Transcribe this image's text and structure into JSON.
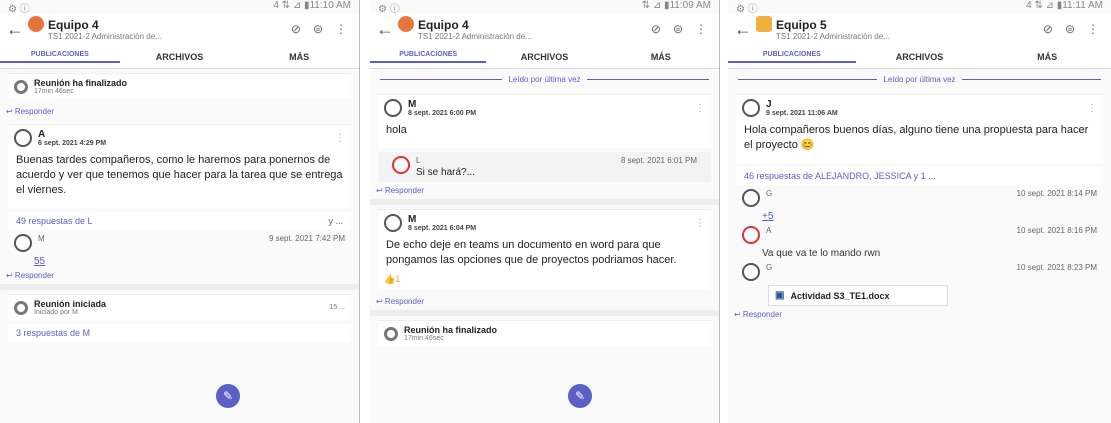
{
  "panels": [
    {
      "status_time": "4 ⇅ ⊿ ▮11:10 AM",
      "team_name": "Equipo 4",
      "subtitle": "TS1 2021-2 Administración de...",
      "tabs": [
        "PUBLICACIONES",
        "ARCHIVOS",
        "MÁS"
      ],
      "system1": {
        "title": "Reunión ha finalizado",
        "sub": "17min 46sec"
      },
      "reply_label": "↩ Responder",
      "post": {
        "author": "A",
        "date": "6 sept. 2021 4:29 PM",
        "body": "Buenas tardes compañeros, como le haremos para ponernos de acuerdo y ver que tenemos que hacer para la tarea que se entrega el viernes."
      },
      "replies_label": "49 respuestas de L",
      "replies_tail": "y ...",
      "subreply": {
        "author": "M",
        "date": "9 sept. 2021 7:42 PM",
        "text": "55"
      },
      "system2": {
        "title": "Reunión iniciada",
        "sub": "Iniciado por M",
        "tail": "15 ..."
      },
      "replies2_label": "3 respuestas de M"
    },
    {
      "status_time": "⇅ ⊿ ▮11:09 AM",
      "team_name": "Equipo 4",
      "subtitle": "TS1 2021-2 Administración de...",
      "tabs": [
        "PUBLICACIONES",
        "ARCHIVOS",
        "MÁS"
      ],
      "last_read": "Leído por última vez",
      "post1": {
        "author": "M",
        "date": "8 sept. 2021 6:00 PM",
        "body": "hola"
      },
      "subreply": {
        "author": "L",
        "date": "8 sept. 2021 6:01 PM",
        "text": "Si se hará?..."
      },
      "reply_label": "↩ Responder",
      "post2": {
        "author": "M",
        "date": "8 sept. 2021 6:04 PM",
        "body": "De echo deje en teams un documento en word para que pongamos las opciones que de proyectos podriamos hacer."
      },
      "reaction": "👍1",
      "system": {
        "title": "Reunión ha finalizado",
        "sub": "17min 46sec"
      }
    },
    {
      "status_time": "4 ⇅ ⊿ ▮11:11 AM",
      "team_name": "Equipo 5",
      "subtitle": "TS1 2021-2 Administración de...",
      "tabs": [
        "PUBLICACIONES",
        "ARCHIVOS",
        "MÁS"
      ],
      "last_read": "Leído por última vez",
      "post": {
        "author": "J",
        "date": "9 sept. 2021 11:06 AM",
        "body": "Hola compañeros buenos días, alguno tiene una propuesta para hacer el proyecto"
      },
      "replies_label": "46 respuestas de ALEJANDRO, JESSICA y 1 ...",
      "sub1": {
        "author": "G",
        "date": "10 sept. 2021 8:14 PM",
        "text": "+5"
      },
      "sub2": {
        "author": "A",
        "date": "10 sept. 2021 8:16 PM",
        "text": "Va que va te lo mando rwn"
      },
      "sub3": {
        "author": "G",
        "date": "10 sept. 2021 8:23 PM"
      },
      "doc_name": "Actividad S3_TE1.docx",
      "reply_label": "↩ Responder"
    }
  ],
  "icons": {
    "back": "arrow-left-icon",
    "video": "video-off-icon",
    "info": "info-icon",
    "more": "more-vert-icon",
    "compose": "compose-icon"
  },
  "colors": {
    "accent": "#5b5fc7",
    "team4": "#e8743b",
    "team5": "#f0b13a"
  }
}
